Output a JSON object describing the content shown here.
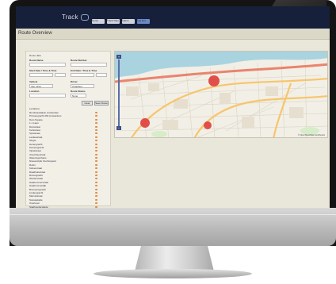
{
  "header": {
    "logo_text": "Track",
    "nav": [
      "Home",
      "Track Trips",
      "Admin",
      "Log Out"
    ]
  },
  "page": {
    "title": "Route Overview"
  },
  "form": {
    "heading": "Route data",
    "fields": [
      {
        "label": "Route Name",
        "value": ""
      },
      {
        "label": "Route Number",
        "value": ""
      },
      {
        "label": "Start Date / Time & Time",
        "value": ""
      },
      {
        "label": "End Date / Time & Time",
        "value": ""
      },
      {
        "label": "Vehicle",
        "value": "Van 1234"
      },
      {
        "label": "Driver",
        "value": "Chauffeur"
      },
      {
        "label": "Location",
        "value": ""
      },
      {
        "label": "Route Status",
        "value": "None"
      }
    ],
    "buttons": [
      "Clear",
      "Save Route"
    ]
  },
  "list": {
    "heading": "Locations",
    "items": [
      "Rembrandtplein Amsterdam",
      "Prinsengracht 263 Amsterdam",
      "Dam Square",
      "1.1 Laan",
      "Damstraat",
      "Kerkstraat",
      "Spuistraat",
      "Leidsestraat",
      "Singel",
      "Herengracht",
      "Keizersgracht",
      "Vijzelstraat",
      "Utrechtsestraat",
      "Weteringschans",
      "Nieuwezijds Voorburgwal",
      "Rokin",
      "Kalverstraat",
      "Raadhuisstraat",
      "Rozengracht",
      "Westerstraat",
      "Haarlemmerstraat",
      "Haarlemmerdijk",
      "Brouwersgracht",
      "Lindengracht",
      "Marnixstraat",
      "Nassaukade",
      "Overtoom",
      "Stadhouderskade",
      "Ferdinand Bolstraat",
      "Ceintuurbaan",
      "Van Woustraat",
      "Sarphatistraat",
      "Plantage Middenlaan",
      "Wibautstraat",
      "Weesperstraat",
      "Amstelveenseweg",
      "Museumplein"
    ]
  },
  "map": {
    "zoom_in": "+",
    "zoom_out": "−",
    "attribution": "© OpenStreetMap contributors",
    "colors": {
      "water": "#a9d3df",
      "land": "#f2efe6",
      "major_road": "#f7c56b",
      "red_road": "#e9846d",
      "marker": "#e0413e"
    }
  }
}
